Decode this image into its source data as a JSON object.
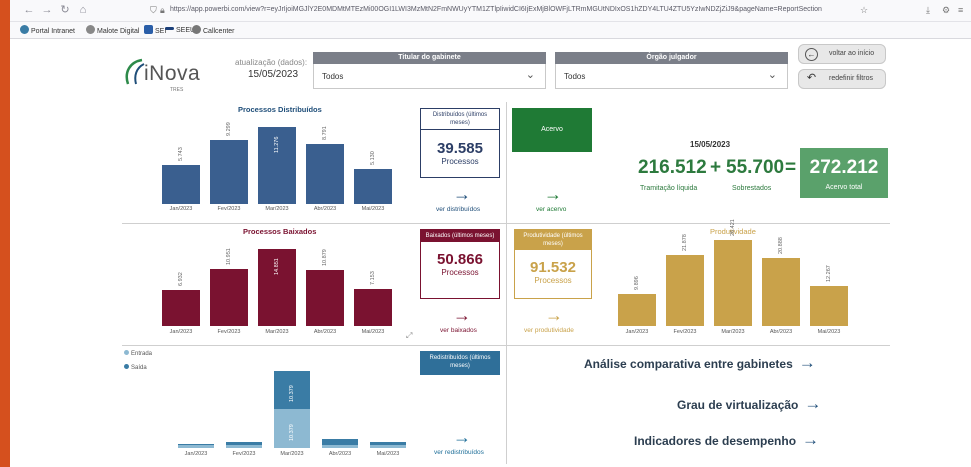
{
  "browser": {
    "url": "https://app.powerbi.com/view?r=eyJrIjoiMGJlY2E0MDMtMTEzMi00OGI1LWI3MzMtN2FmNWUyYTM1ZTlpIiwidCI6IjExMjBlOWFjLTRmMGUtNDIxOS1hZDY4LTU4ZTU5YzIwNDZjZiJ9&pageName=ReportSection",
    "bookmarks": [
      "Portal Intranet",
      "Malote Digital",
      "SEI",
      "SEEU",
      "Callcenter"
    ]
  },
  "header": {
    "logo_text": "iNova",
    "logo_sub": "TRES",
    "update_label": "atualização (dados):",
    "update_date": "15/05/2023",
    "slicer1_title": "Titular do gabinete",
    "slicer1_value": "Todos",
    "slicer2_title": "Órgão julgador",
    "slicer2_value": "Todos",
    "btn_back": "voltar ao início",
    "btn_reset": "redefinir filtros"
  },
  "distribuidos": {
    "title": "Processos Distribuídos",
    "card_head": "Distribuídos (últimos meses)",
    "card_value": "39.585",
    "card_unit": "Processos",
    "link": "ver distribuídos"
  },
  "acervo": {
    "box_label": "Acervo",
    "link": "ver acervo",
    "date": "15/05/2023",
    "tramitacao_value": "216.512",
    "tramitacao_label": "Tramitação líquida",
    "plus": "+",
    "sobrestados_value": "55.700",
    "sobrestados_label": "Sobrestados",
    "equals": "=",
    "total_value": "272.212",
    "total_label": "Acervo total"
  },
  "baixados": {
    "title": "Processos Baixados",
    "card_head": "Baixados (últimos meses)",
    "card_value": "50.866",
    "card_unit": "Processos",
    "link": "ver baixados"
  },
  "produtividade": {
    "title": "Produtividade",
    "card_head": "Produtividade (últimos meses)",
    "card_value": "91.532",
    "card_unit": "Processos",
    "link": "ver produtividade"
  },
  "redistribuidos": {
    "legend_entrada": "Entrada",
    "legend_saida": "Saída",
    "card_head": "Redistribuídos (últimos meses)",
    "link": "ver redistribuídos"
  },
  "links": {
    "analise": "Análise comparativa entre gabinetes",
    "virtualizacao": "Grau de virtualização",
    "indicadores": "Indicadores de desempenho"
  },
  "colors": {
    "distribuidos": "#3a5f8f",
    "baixados": "#7a1230",
    "produtividade": "#c9a24a",
    "acervo": "#1f7a35",
    "entrada": "#3a7ca5",
    "saida": "#8db9d2"
  },
  "chart_data": [
    {
      "type": "bar",
      "title": "Processos Distribuídos",
      "categories": [
        "Jan/2023",
        "Fev/2023",
        "Mar/2023",
        "Abr/2023",
        "Mai/2023"
      ],
      "values": [
        5743,
        9299,
        11276,
        8791,
        5130
      ],
      "labels": [
        "5.743",
        "9.299",
        "11.276",
        "8.791",
        "5.130"
      ]
    },
    {
      "type": "bar",
      "title": "Processos Baixados",
      "categories": [
        "Jan/2023",
        "Fev/2023",
        "Mar/2023",
        "Abr/2023",
        "Mai/2023"
      ],
      "values": [
        6932,
        10951,
        14851,
        10879,
        7153
      ],
      "labels": [
        "6.932",
        "10.951",
        "14.851",
        "10.879",
        "7.153"
      ]
    },
    {
      "type": "bar",
      "title": "Produtividade",
      "categories": [
        "Jan/2023",
        "Fev/2023",
        "Mar/2023",
        "Abr/2023",
        "Mai/2023"
      ],
      "values": [
        9896,
        21878,
        26421,
        20888,
        12267
      ],
      "labels": [
        "9.896",
        "21.878",
        "26.421",
        "20.888",
        "12.267"
      ]
    },
    {
      "type": "bar",
      "stacked": true,
      "title": "",
      "categories": [
        "Jan/2023",
        "Fev/2023",
        "Mar/2023",
        "Abr/2023",
        "Mai/2023"
      ],
      "series": [
        {
          "name": "Saída",
          "values": [
            700,
            900,
            10379,
            900,
            700
          ],
          "labels": [
            "",
            "",
            "10.379",
            "",
            ""
          ]
        },
        {
          "name": "Entrada",
          "values": [
            500,
            700,
            10379,
            1400,
            800
          ],
          "labels": [
            "",
            "",
            "10.379",
            "",
            ""
          ]
        }
      ]
    }
  ]
}
